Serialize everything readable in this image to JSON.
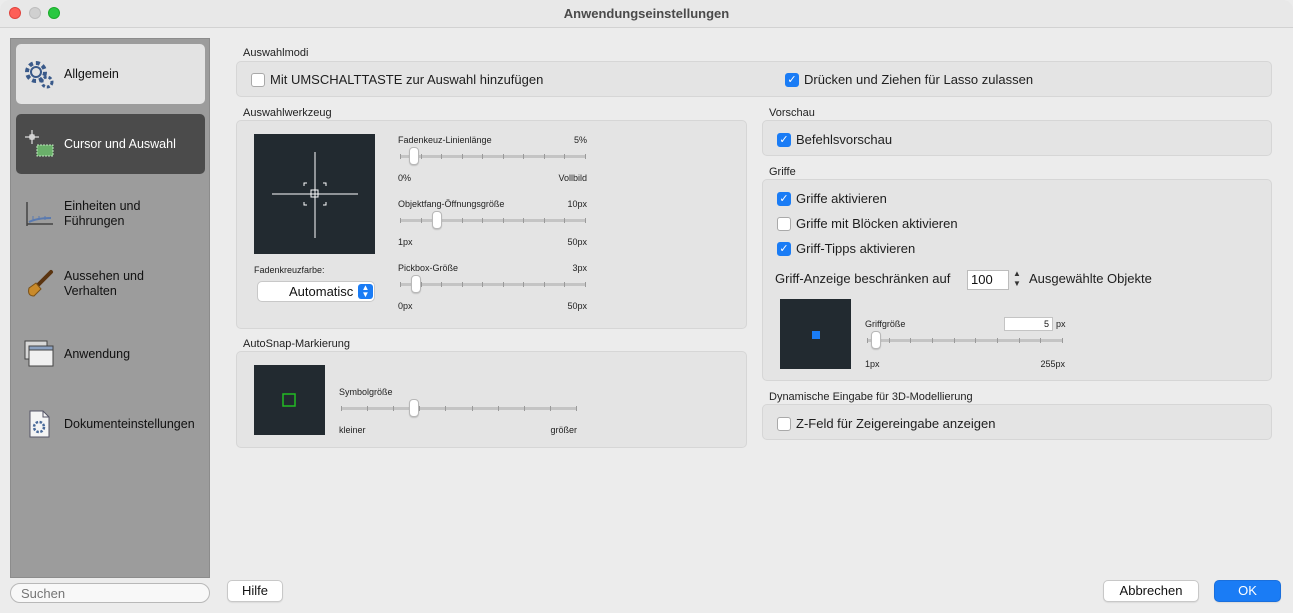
{
  "window": {
    "title": "Anwendungseinstellungen"
  },
  "sidebar": {
    "items": [
      {
        "label": "Allgemein",
        "icon": "gear-icon"
      },
      {
        "label": "Cursor und Auswahl",
        "icon": "cursor-selection-icon"
      },
      {
        "label": "Einheiten und Führungen",
        "icon": "units-ruler-icon"
      },
      {
        "label": "Aussehen und Verhalten",
        "icon": "brush-icon"
      },
      {
        "label": "Anwendung",
        "icon": "windows-icon"
      },
      {
        "label": "Dokumenteinstellungen",
        "icon": "document-gear-icon"
      }
    ],
    "selected": "Cursor und Auswahl",
    "search_placeholder": "Suchen"
  },
  "auswahlmodi": {
    "title": "Auswahlmodi",
    "shift_add": {
      "label": "Mit UMSCHALTTASTE zur Auswahl hinzufügen",
      "checked": false
    },
    "lasso": {
      "label": "Drücken und Ziehen für Lasso zulassen",
      "checked": true
    }
  },
  "auswahlwerkzeug": {
    "title": "Auswahlwerkzeug",
    "crosshair_color_label": "Fadenkreuzfarbe:",
    "crosshair_color_value": "Automatisch",
    "crosshair_color_visible": "Automatisc",
    "slider_crosshair": {
      "label": "Fadenkeuz-Linienlänge",
      "value": "5%",
      "min": "0%",
      "max": "Vollbild",
      "pos": 0.05
    },
    "slider_aperture": {
      "label": "Objektfang-Öffnungsgröße",
      "value": "10px",
      "min": "1px",
      "max": "50px",
      "pos": 0.18
    },
    "slider_pickbox": {
      "label": "Pickbox-Größe",
      "value": "3px",
      "min": "0px",
      "max": "50px",
      "pos": 0.06
    }
  },
  "autosnap": {
    "title": "AutoSnap-Markierung",
    "slider_symbol": {
      "label": "Symbolgröße",
      "min": "kleiner",
      "max": "größer",
      "pos": 0.3
    }
  },
  "vorschau": {
    "title": "Vorschau",
    "command_preview": {
      "label": "Befehlsvorschau",
      "checked": true
    }
  },
  "griffe": {
    "title": "Griffe",
    "enable": {
      "label": "Griffe aktivieren",
      "checked": true
    },
    "blocks": {
      "label": "Griffe mit Blöcken aktivieren",
      "checked": false
    },
    "tips": {
      "label": "Griff-Tipps aktivieren",
      "checked": true
    },
    "limit_label": "Griff-Anzeige beschränken auf",
    "limit_value": "100",
    "limit_suffix": "Ausgewählte Objekte",
    "size_label": "Griffgröße",
    "size_value": "5",
    "size_unit": "px",
    "size_min": "1px",
    "size_max": "255px",
    "size_pos": 0.02,
    "grip_color": "#1a7cf5"
  },
  "dynamisch": {
    "title": "Dynamische Eingabe für 3D-Modellierung",
    "zfield": {
      "label": "Z-Feld für Zeigereingabe anzeigen",
      "checked": false
    }
  },
  "buttons": {
    "help": "Hilfe",
    "cancel": "Abbrechen",
    "ok": "OK"
  },
  "colors": {
    "accent": "#1a7cf5",
    "preview_bg": "#222a30",
    "snap_marker": "#22bb22"
  }
}
